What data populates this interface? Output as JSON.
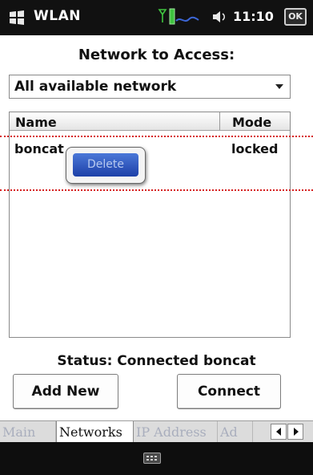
{
  "titlebar": {
    "app_name": "WLAN",
    "time": "11:10",
    "ok_label": "OK",
    "icons": [
      "windows-logo-icon",
      "signal-strength-icon",
      "volume-icon"
    ]
  },
  "heading": "Network to Access:",
  "filter": {
    "selected": "All available network"
  },
  "network_list": {
    "columns": [
      "Name",
      "Mode"
    ],
    "rows": [
      {
        "name": "boncat",
        "mode": "locked"
      }
    ]
  },
  "context_menu": {
    "items": [
      "Delete"
    ]
  },
  "status": "Status: Connected boncat",
  "buttons": {
    "add_new": "Add New",
    "connect": "Connect"
  },
  "tabs": [
    "Main",
    "Networks",
    "IP Address",
    "Ad"
  ],
  "active_tab": "Networks",
  "colors": {
    "title_bar": "#111111",
    "menu_highlight": "#1d40a8",
    "guide_line": "#d62020"
  }
}
